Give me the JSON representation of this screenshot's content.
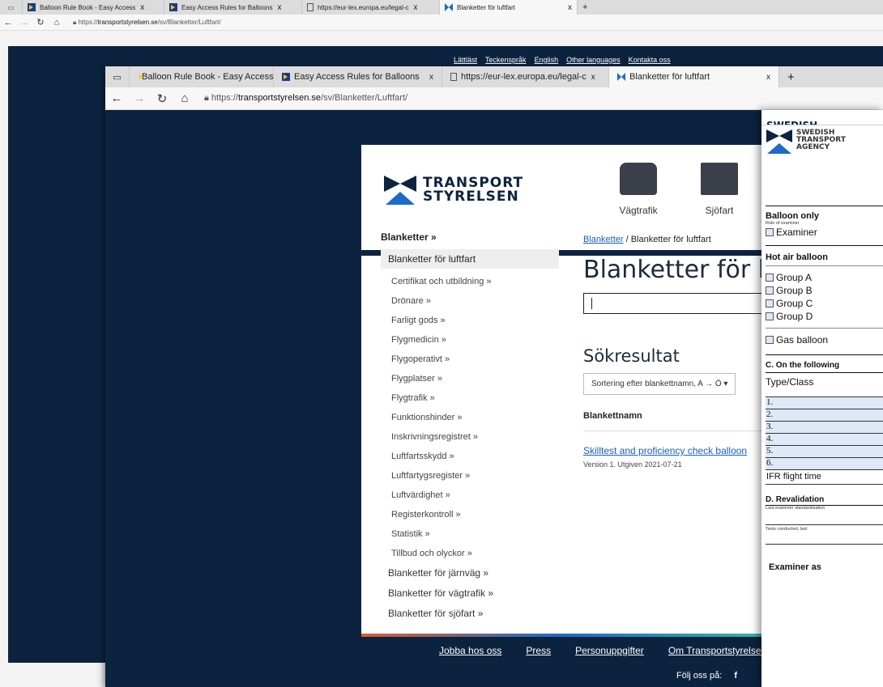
{
  "back_window": {
    "tabs": [
      {
        "label": "Balloon Rule Book - Easy Access",
        "close": "x"
      },
      {
        "label": "Easy Access Rules for Balloons",
        "close": "x"
      },
      {
        "label": "https://eur-lex.europa.eu/legal-c",
        "close": "x"
      },
      {
        "label": "Blanketter för luftfart",
        "close": "x"
      }
    ],
    "new_tab": "+",
    "url_prefix": "https://",
    "url_host": "transportstyrelsen.se",
    "url_path": "/sv/Blanketter/Luftfart/",
    "toplinks": [
      "Lättläst",
      "Teckenspråk",
      "English",
      "Other languages",
      "Kontakta oss"
    ]
  },
  "mid_window": {
    "tabs": [
      {
        "label": "Balloon Rule Book - Easy Access",
        "close": ""
      },
      {
        "label": "Easy Access Rules for Balloons",
        "close": "x"
      },
      {
        "label": "https://eur-lex.europa.eu/legal-c",
        "close": "x"
      },
      {
        "label": "Blanketter för luftfart",
        "close": "x"
      }
    ],
    "new_tab": "+",
    "url_prefix": "https://",
    "url_host": "transportstyrelsen.se",
    "url_path": "/sv/Blanketter/Luftfart/"
  },
  "site": {
    "logo_line1": "TRANSPORT",
    "logo_line2": "STYRELSEN",
    "categories": [
      "Vägtrafik",
      "Sjöfart"
    ],
    "sidebar": {
      "root": "Blanketter »",
      "current": "Blanketter för luftfart",
      "subitems": [
        "Certifikat och utbildning »",
        "Drönare »",
        "Farligt gods »",
        "Flygmedicin »",
        "Flygoperativt »",
        "Flygplatser »",
        "Flygtrafik »",
        "Funktionshinder »",
        "Inskrivningsregistret »",
        "Luftfartsskydd »",
        "Luftfartygsregister »",
        "Luftvärdighet »",
        "Registerkontroll »",
        "Statistik »",
        "Tillbud och olyckor »"
      ],
      "top_items": [
        "Blanketter för järnväg »",
        "Blanketter för vägtrafik »",
        "Blanketter för sjöfart »"
      ]
    },
    "breadcrumb_link": "Blanketter",
    "breadcrumb_sep": "/",
    "breadcrumb_current": "Blanketter för luftfart",
    "page_title": "Blanketter för luftfart",
    "results_heading": "Sökresultat",
    "sort_label": "Sortering efter blankettnamn, A → Ö ▾",
    "column_header": "Blankettnamn",
    "result_link": "Skilltest and proficiency check balloon",
    "result_meta": "Version 1. Utgiven 2021-07-21",
    "footer_links": [
      "Jobba hos oss",
      "Press",
      "Personuppgifter",
      "Om Transportstyrelsen"
    ],
    "follow_label": "Följ oss på:",
    "follow_icon": "f"
  },
  "pdf": {
    "behind_title": "SWEDISH",
    "org_line1": "SWEDISH",
    "org_line2": "TRANSPORT",
    "org_line3": "AGENCY",
    "balloon_only": "Balloon only",
    "role_label": "Role of examiner",
    "role_option": "Examiner",
    "hot_air": "Hot air balloon",
    "groups": [
      "Group A",
      "Group B",
      "Group C",
      "Group D"
    ],
    "gas": "Gas balloon",
    "section_c": "C. On the following",
    "type_class": "Type/Class",
    "rows": [
      "1.",
      "2.",
      "3.",
      "4.",
      "5.",
      "6."
    ],
    "ifr": "IFR flight time",
    "section_d": "D. Revalidation",
    "last_examiner": "Last examiner standardisation",
    "tests_conducted": "Tests conducted, last",
    "examiner_as": "Examiner as"
  }
}
